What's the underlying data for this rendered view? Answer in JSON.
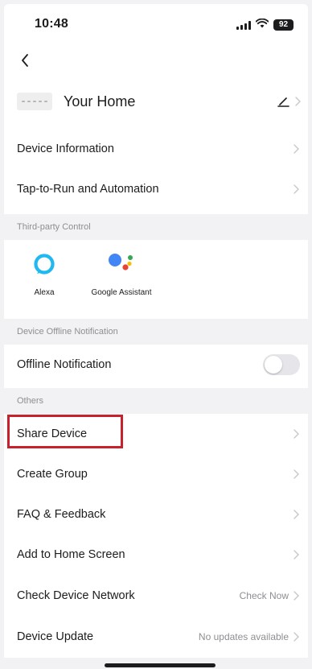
{
  "status_bar": {
    "time": "10:48",
    "battery": "92"
  },
  "home": {
    "name": "Your Home"
  },
  "rows_top": [
    {
      "label": "Device Information"
    },
    {
      "label": "Tap-to-Run and Automation"
    }
  ],
  "third_party": {
    "header": "Third-party Control",
    "items": [
      {
        "label": "Alexa",
        "icon": "alexa-icon"
      },
      {
        "label": "Google Assistant",
        "icon": "google-assistant-icon"
      }
    ]
  },
  "offline": {
    "header": "Device Offline Notification",
    "label": "Offline Notification",
    "toggle_on": false
  },
  "others": {
    "header": "Others",
    "items": [
      {
        "label": "Share Device",
        "value": ""
      },
      {
        "label": "Create Group",
        "value": ""
      },
      {
        "label": "FAQ & Feedback",
        "value": ""
      },
      {
        "label": "Add to Home Screen",
        "value": ""
      },
      {
        "label": "Check Device Network",
        "value": "Check Now"
      },
      {
        "label": "Device Update",
        "value": "No updates available"
      }
    ]
  },
  "colors": {
    "highlight": "#c8202c",
    "alexa_ring": "#1fb8f0",
    "google_blue": "#4285f4",
    "google_red": "#ea4335",
    "google_yellow": "#fbbc05",
    "google_green": "#34a853"
  }
}
